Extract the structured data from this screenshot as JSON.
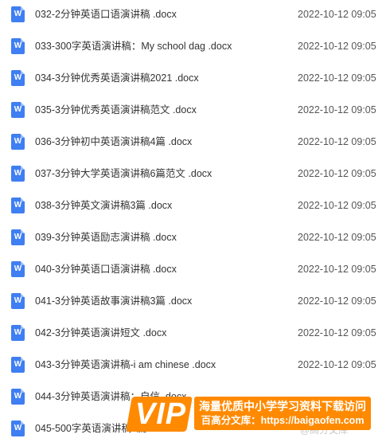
{
  "files": [
    {
      "name": "032-2分钟英语口语演讲稿 .docx",
      "date": "2022-10-12 09:05",
      "icon": "word-doc-icon"
    },
    {
      "name": "033-300字英语演讲稿：My school dag .docx",
      "date": "2022-10-12 09:05",
      "icon": "word-doc-icon"
    },
    {
      "name": "034-3分钟优秀英语演讲稿2021 .docx",
      "date": "2022-10-12 09:05",
      "icon": "word-doc-icon"
    },
    {
      "name": "035-3分钟优秀英语演讲稿范文 .docx",
      "date": "2022-10-12 09:05",
      "icon": "word-doc-icon"
    },
    {
      "name": "036-3分钟初中英语演讲稿4篇 .docx",
      "date": "2022-10-12 09:05",
      "icon": "word-doc-icon"
    },
    {
      "name": "037-3分钟大学英语演讲稿6篇范文 .docx",
      "date": "2022-10-12 09:05",
      "icon": "word-doc-icon"
    },
    {
      "name": "038-3分钟英文演讲稿3篇 .docx",
      "date": "2022-10-12 09:05",
      "icon": "word-doc-icon"
    },
    {
      "name": "039-3分钟英语励志演讲稿 .docx",
      "date": "2022-10-12 09:05",
      "icon": "word-doc-icon"
    },
    {
      "name": "040-3分钟英语口语演讲稿 .docx",
      "date": "2022-10-12 09:05",
      "icon": "word-doc-icon"
    },
    {
      "name": "041-3分钟英语故事演讲稿3篇 .docx",
      "date": "2022-10-12 09:05",
      "icon": "word-doc-icon"
    },
    {
      "name": "042-3分钟英语演讲短文 .docx",
      "date": "2022-10-12 09:05",
      "icon": "word-doc-icon"
    },
    {
      "name": "043-3分钟英语演讲稿-i am chinese .docx",
      "date": "2022-10-12 09:05",
      "icon": "word-doc-icon"
    },
    {
      "name": "044-3分钟英语演讲稿：自信 .docx",
      "date": "",
      "icon": "word-doc-icon"
    },
    {
      "name": "045-500字英语演讲稿6篇 .docx",
      "date": "",
      "icon": "word-doc-icon"
    }
  ],
  "icon_letter": "W",
  "banner": {
    "vip_label": "VIP",
    "line1": "海量优质中小学学习资料下载访问",
    "line2": "百高分文库：https://baigaofen.com"
  },
  "watermark": "@高分文库",
  "colors": {
    "accent": "#ff8a00",
    "word_icon": "#3f7ef3"
  }
}
